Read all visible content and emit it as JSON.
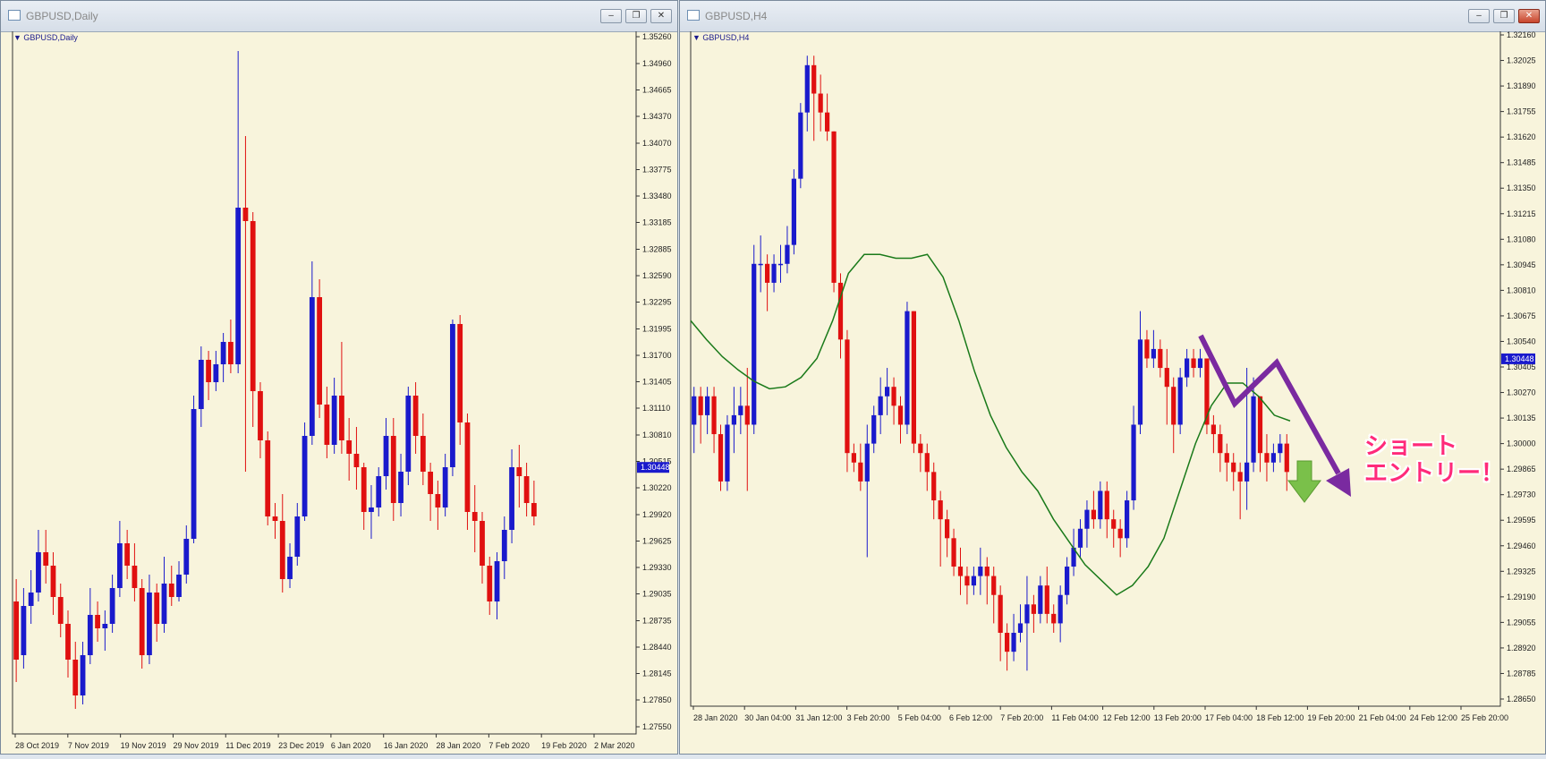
{
  "windows": {
    "left": {
      "title": "GBPUSD,Daily",
      "symbol_label": "GBPUSD,Daily"
    },
    "right": {
      "title": "GBPUSD,H4",
      "symbol_label": "GBPUSD,H4"
    }
  },
  "colors": {
    "bull": "#1a1acc",
    "bear": "#e01010",
    "ma": "#1a7a1a",
    "arrow_purple": "#7a2aa0",
    "arrow_green": "#7ac04a",
    "background": "#f8f4dc",
    "price_tag": "#1a1acc"
  },
  "annotation": {
    "line1": "ショート",
    "line2": "エントリー！"
  },
  "chart_data": [
    {
      "type": "candlestick",
      "title": "GBPUSD,Daily",
      "y_ticks": [
        "1.35260",
        "1.34960",
        "1.34665",
        "1.34370",
        "1.34070",
        "1.33775",
        "1.33480",
        "1.33185",
        "1.32885",
        "1.32590",
        "1.32295",
        "1.31995",
        "1.31700",
        "1.31405",
        "1.31110",
        "1.30810",
        "1.30515",
        "1.30220",
        "1.29920",
        "1.29625",
        "1.29330",
        "1.29035",
        "1.28735",
        "1.28440",
        "1.28145",
        "1.27850",
        "1.27550"
      ],
      "ylim": [
        1.2755,
        1.3526
      ],
      "current_price": "1.30448",
      "x_labels": [
        "28 Oct 2019",
        "7 Nov 2019",
        "19 Nov 2019",
        "29 Nov 2019",
        "11 Dec 2019",
        "23 Dec 2019",
        "6 Jan 2020",
        "16 Jan 2020",
        "28 Jan 2020",
        "7 Feb 2020",
        "19 Feb 2020",
        "2 Mar 2020"
      ],
      "candles": [
        [
          1.2895,
          1.283,
          1.292,
          1.2805
        ],
        [
          1.2835,
          1.289,
          1.291,
          1.282
        ],
        [
          1.289,
          1.2905,
          1.293,
          1.287
        ],
        [
          1.2905,
          1.295,
          1.2975,
          1.2895
        ],
        [
          1.295,
          1.2935,
          1.2975,
          1.2915
        ],
        [
          1.2935,
          1.29,
          1.295,
          1.288
        ],
        [
          1.29,
          1.287,
          1.2915,
          1.2855
        ],
        [
          1.287,
          1.283,
          1.2885,
          1.281
        ],
        [
          1.283,
          1.279,
          1.285,
          1.2775
        ],
        [
          1.279,
          1.2835,
          1.285,
          1.278
        ],
        [
          1.2835,
          1.288,
          1.291,
          1.2825
        ],
        [
          1.288,
          1.2865,
          1.2895,
          1.285
        ],
        [
          1.2865,
          1.287,
          1.2885,
          1.284
        ],
        [
          1.287,
          1.291,
          1.2925,
          1.286
        ],
        [
          1.291,
          1.296,
          1.2985,
          1.29
        ],
        [
          1.296,
          1.2935,
          1.2975,
          1.292
        ],
        [
          1.2935,
          1.291,
          1.296,
          1.2895
        ],
        [
          1.291,
          1.2835,
          1.292,
          1.282
        ],
        [
          1.2835,
          1.2905,
          1.2925,
          1.2825
        ],
        [
          1.2905,
          1.287,
          1.2915,
          1.285
        ],
        [
          1.287,
          1.2915,
          1.2945,
          1.286
        ],
        [
          1.2915,
          1.29,
          1.2935,
          1.289
        ],
        [
          1.29,
          1.2925,
          1.294,
          1.2895
        ],
        [
          1.2925,
          1.2965,
          1.298,
          1.2915
        ],
        [
          1.2965,
          1.311,
          1.3125,
          1.296
        ],
        [
          1.311,
          1.3165,
          1.318,
          1.309
        ],
        [
          1.3165,
          1.314,
          1.3175,
          1.312
        ],
        [
          1.314,
          1.316,
          1.3175,
          1.313
        ],
        [
          1.316,
          1.3185,
          1.3195,
          1.314
        ],
        [
          1.3185,
          1.316,
          1.321,
          1.315
        ],
        [
          1.316,
          1.3335,
          1.351,
          1.315
        ],
        [
          1.3335,
          1.332,
          1.3415,
          1.304
        ],
        [
          1.332,
          1.313,
          1.333,
          1.309
        ],
        [
          1.313,
          1.3075,
          1.314,
          1.3055
        ],
        [
          1.3075,
          1.299,
          1.3085,
          1.298
        ],
        [
          1.299,
          1.2985,
          1.3005,
          1.2965
        ],
        [
          1.2985,
          1.292,
          1.3015,
          1.2905
        ],
        [
          1.292,
          1.2945,
          1.296,
          1.291
        ],
        [
          1.2945,
          1.299,
          1.3005,
          1.2935
        ],
        [
          1.299,
          1.308,
          1.3095,
          1.2985
        ],
        [
          1.308,
          1.3235,
          1.3275,
          1.307
        ],
        [
          1.3235,
          1.3115,
          1.3255,
          1.31
        ],
        [
          1.3115,
          1.307,
          1.3135,
          1.3055
        ],
        [
          1.307,
          1.3125,
          1.3145,
          1.306
        ],
        [
          1.3125,
          1.3075,
          1.3185,
          1.306
        ],
        [
          1.3075,
          1.306,
          1.31,
          1.303
        ],
        [
          1.306,
          1.3045,
          1.309,
          1.302
        ],
        [
          1.3045,
          1.2995,
          1.305,
          1.2975
        ],
        [
          1.2995,
          1.3,
          1.3025,
          1.2965
        ],
        [
          1.3,
          1.3035,
          1.3045,
          1.299
        ],
        [
          1.3035,
          1.308,
          1.31,
          1.302
        ],
        [
          1.308,
          1.3005,
          1.31,
          1.2985
        ],
        [
          1.3005,
          1.304,
          1.306,
          1.299
        ],
        [
          1.304,
          1.3125,
          1.3135,
          1.3025
        ],
        [
          1.3125,
          1.308,
          1.314,
          1.306
        ],
        [
          1.308,
          1.304,
          1.3105,
          1.3025
        ],
        [
          1.304,
          1.3015,
          1.305,
          1.2985
        ],
        [
          1.3015,
          1.3,
          1.303,
          1.2975
        ],
        [
          1.3,
          1.3045,
          1.306,
          1.299
        ],
        [
          1.3045,
          1.3205,
          1.321,
          1.3035
        ],
        [
          1.3205,
          1.3095,
          1.3215,
          1.307
        ],
        [
          1.3095,
          1.2995,
          1.3105,
          1.2975
        ],
        [
          1.2995,
          1.2985,
          1.3025,
          1.295
        ],
        [
          1.2985,
          1.2935,
          1.2995,
          1.2915
        ],
        [
          1.2935,
          1.2895,
          1.2945,
          1.288
        ],
        [
          1.2895,
          1.294,
          1.295,
          1.2875
        ],
        [
          1.294,
          1.2975,
          1.299,
          1.292
        ],
        [
          1.2975,
          1.3045,
          1.3065,
          1.296
        ],
        [
          1.3045,
          1.3035,
          1.307,
          1.3
        ],
        [
          1.3035,
          1.3005,
          1.305,
          1.299
        ],
        [
          1.3005,
          1.299,
          1.303,
          1.298
        ]
      ]
    },
    {
      "type": "candlestick",
      "title": "GBPUSD,H4",
      "y_ticks": [
        "1.32160",
        "1.32025",
        "1.31890",
        "1.31755",
        "1.31620",
        "1.31485",
        "1.31350",
        "1.31215",
        "1.31080",
        "1.30945",
        "1.30810",
        "1.30675",
        "1.30540",
        "1.30405",
        "1.30270",
        "1.30135",
        "1.30000",
        "1.29865",
        "1.29730",
        "1.29595",
        "1.29460",
        "1.29325",
        "1.29190",
        "1.29055",
        "1.28920",
        "1.28785",
        "1.28650"
      ],
      "ylim": [
        1.2865,
        1.3216
      ],
      "current_price": "1.30448",
      "x_labels": [
        "28 Jan 2020",
        "30 Jan 04:00",
        "31 Jan 12:00",
        "3 Feb 20:00",
        "5 Feb 04:00",
        "6 Feb 12:00",
        "7 Feb 20:00",
        "11 Feb 04:00",
        "12 Feb 12:00",
        "13 Feb 20:00",
        "17 Feb 04:00",
        "18 Feb 12:00",
        "19 Feb 20:00",
        "21 Feb 04:00",
        "24 Feb 12:00",
        "25 Feb 20:00"
      ],
      "candles": [
        [
          1.301,
          1.3025,
          1.303,
          1.2995
        ],
        [
          1.3025,
          1.3015,
          1.303,
          1.3
        ],
        [
          1.3015,
          1.3025,
          1.303,
          1.3005
        ],
        [
          1.3025,
          1.3005,
          1.303,
          1.2995
        ],
        [
          1.3005,
          1.298,
          1.301,
          1.2975
        ],
        [
          1.298,
          1.301,
          1.3015,
          1.2975
        ],
        [
          1.301,
          1.3015,
          1.303,
          1.2995
        ],
        [
          1.3015,
          1.302,
          1.303,
          1.3005
        ],
        [
          1.302,
          1.301,
          1.304,
          1.2975
        ],
        [
          1.301,
          1.3095,
          1.3105,
          1.3005
        ],
        [
          1.3095,
          1.3095,
          1.311,
          1.308
        ],
        [
          1.3095,
          1.3085,
          1.31,
          1.307
        ],
        [
          1.3085,
          1.3095,
          1.31,
          1.308
        ],
        [
          1.3095,
          1.3095,
          1.3105,
          1.3085
        ],
        [
          1.3095,
          1.3105,
          1.3115,
          1.309
        ],
        [
          1.3105,
          1.314,
          1.3145,
          1.31
        ],
        [
          1.314,
          1.3175,
          1.318,
          1.3135
        ],
        [
          1.3175,
          1.32,
          1.3205,
          1.3165
        ],
        [
          1.32,
          1.3185,
          1.3205,
          1.316
        ],
        [
          1.3185,
          1.3175,
          1.3195,
          1.3165
        ],
        [
          1.3175,
          1.3165,
          1.3185,
          1.316
        ],
        [
          1.3165,
          1.3085,
          1.3165,
          1.308
        ],
        [
          1.3085,
          1.3055,
          1.309,
          1.3045
        ],
        [
          1.3055,
          1.2995,
          1.306,
          1.2985
        ],
        [
          1.2995,
          1.299,
          1.3,
          1.2985
        ],
        [
          1.299,
          1.298,
          1.3,
          1.2975
        ],
        [
          1.298,
          1.3,
          1.301,
          1.294
        ],
        [
          1.3,
          1.3015,
          1.302,
          1.2995
        ],
        [
          1.3015,
          1.3025,
          1.3035,
          1.3005
        ],
        [
          1.3025,
          1.303,
          1.304,
          1.3015
        ],
        [
          1.303,
          1.302,
          1.3035,
          1.301
        ],
        [
          1.302,
          1.301,
          1.3025,
          1.3
        ],
        [
          1.301,
          1.307,
          1.3075,
          1.3005
        ],
        [
          1.307,
          1.3,
          1.307,
          1.2995
        ],
        [
          1.3,
          1.2995,
          1.3005,
          1.2985
        ],
        [
          1.2995,
          1.2985,
          1.3,
          1.2975
        ],
        [
          1.2985,
          1.297,
          1.299,
          1.296
        ],
        [
          1.297,
          1.296,
          1.2975,
          1.2935
        ],
        [
          1.296,
          1.295,
          1.2965,
          1.294
        ],
        [
          1.295,
          1.2935,
          1.2955,
          1.293
        ],
        [
          1.2935,
          1.293,
          1.2945,
          1.292
        ],
        [
          1.293,
          1.2925,
          1.2935,
          1.2915
        ],
        [
          1.2925,
          1.293,
          1.2935,
          1.292
        ],
        [
          1.293,
          1.2935,
          1.2945,
          1.292
        ],
        [
          1.2935,
          1.293,
          1.294,
          1.2915
        ],
        [
          1.293,
          1.292,
          1.2935,
          1.2905
        ],
        [
          1.292,
          1.29,
          1.2925,
          1.2885
        ],
        [
          1.29,
          1.289,
          1.2905,
          1.288
        ],
        [
          1.289,
          1.29,
          1.291,
          1.2885
        ],
        [
          1.29,
          1.2905,
          1.2915,
          1.2895
        ],
        [
          1.2905,
          1.2915,
          1.293,
          1.288
        ],
        [
          1.2915,
          1.291,
          1.292,
          1.29
        ],
        [
          1.291,
          1.2925,
          1.293,
          1.2905
        ],
        [
          1.2925,
          1.291,
          1.2935,
          1.2905
        ],
        [
          1.291,
          1.2905,
          1.2915,
          1.29
        ],
        [
          1.2905,
          1.292,
          1.2925,
          1.2895
        ],
        [
          1.292,
          1.2935,
          1.294,
          1.2915
        ],
        [
          1.2935,
          1.2945,
          1.2955,
          1.293
        ],
        [
          1.2945,
          1.2955,
          1.296,
          1.294
        ],
        [
          1.2955,
          1.2965,
          1.297,
          1.2945
        ],
        [
          1.2965,
          1.296,
          1.2975,
          1.2955
        ],
        [
          1.296,
          1.2975,
          1.298,
          1.2955
        ],
        [
          1.2975,
          1.296,
          1.298,
          1.295
        ],
        [
          1.296,
          1.2955,
          1.2965,
          1.2945
        ],
        [
          1.2955,
          1.295,
          1.296,
          1.294
        ],
        [
          1.295,
          1.297,
          1.2975,
          1.2945
        ],
        [
          1.297,
          1.301,
          1.302,
          1.2965
        ],
        [
          1.301,
          1.3055,
          1.307,
          1.3005
        ],
        [
          1.3055,
          1.3045,
          1.306,
          1.304
        ],
        [
          1.3045,
          1.305,
          1.306,
          1.304
        ],
        [
          1.305,
          1.304,
          1.3055,
          1.3035
        ],
        [
          1.304,
          1.303,
          1.305,
          1.301
        ],
        [
          1.303,
          1.301,
          1.3035,
          1.2995
        ],
        [
          1.301,
          1.3035,
          1.304,
          1.3005
        ],
        [
          1.3035,
          1.3045,
          1.305,
          1.303
        ],
        [
          1.3045,
          1.304,
          1.305,
          1.3035
        ],
        [
          1.304,
          1.3045,
          1.305,
          1.3035
        ],
        [
          1.3045,
          1.301,
          1.3045,
          1.3005
        ],
        [
          1.301,
          1.3005,
          1.3015,
          1.2995
        ],
        [
          1.3005,
          1.2995,
          1.301,
          1.2985
        ],
        [
          1.2995,
          1.299,
          1.3,
          1.298
        ],
        [
          1.299,
          1.2985,
          1.2995,
          1.2975
        ],
        [
          1.2985,
          1.298,
          1.299,
          1.296
        ],
        [
          1.298,
          1.299,
          1.304,
          1.2965
        ],
        [
          1.299,
          1.3025,
          1.3035,
          1.2985
        ],
        [
          1.3025,
          1.2995,
          1.3025,
          1.2985
        ],
        [
          1.2995,
          1.299,
          1.3005,
          1.298
        ],
        [
          1.299,
          1.2995,
          1.3,
          1.2985
        ],
        [
          1.2995,
          1.3,
          1.3005,
          1.299
        ],
        [
          1.3,
          1.2985,
          1.3005,
          1.2975
        ]
      ],
      "moving_average": [
        1.3065,
        1.3055,
        1.3046,
        1.3039,
        1.3033,
        1.3029,
        1.303,
        1.3035,
        1.3045,
        1.3065,
        1.309,
        1.31,
        1.31,
        1.3098,
        1.3098,
        1.31,
        1.3088,
        1.3065,
        1.3038,
        1.3015,
        1.2998,
        1.2985,
        1.2975,
        1.296,
        1.2948,
        1.2936,
        1.2928,
        1.292,
        1.2925,
        1.2935,
        1.295,
        1.2975,
        1.3,
        1.302,
        1.3032,
        1.3032,
        1.3025,
        1.3015,
        1.3012
      ]
    }
  ]
}
